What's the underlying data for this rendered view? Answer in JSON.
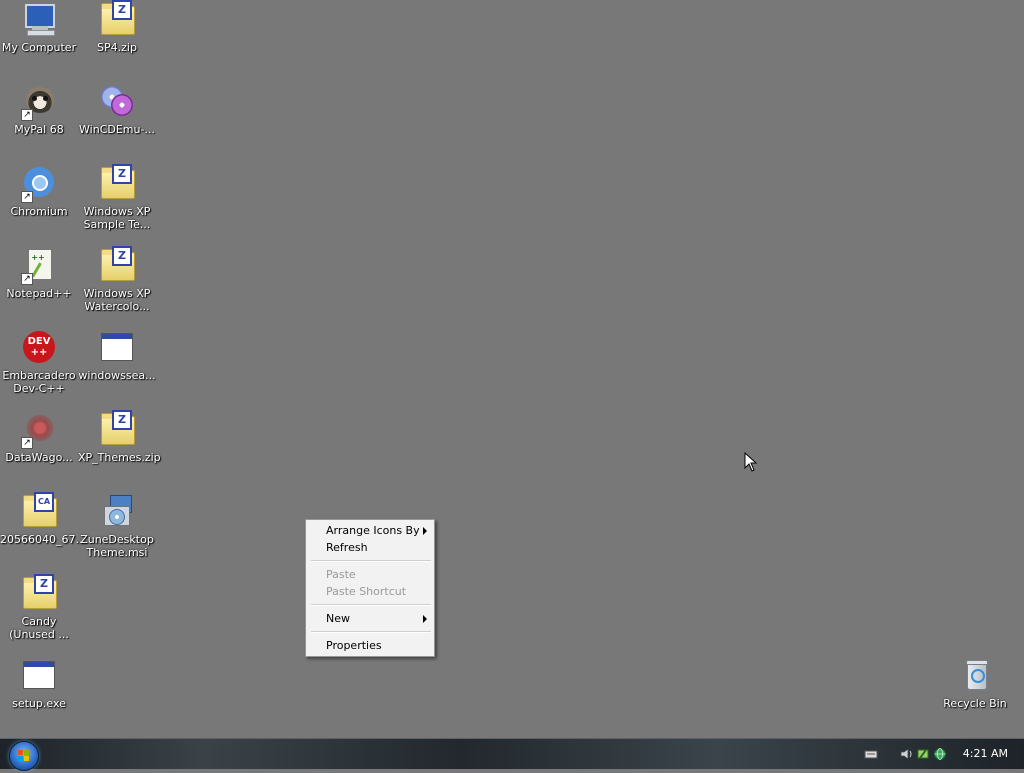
{
  "desktop": {
    "icons": [
      {
        "label": "My Computer",
        "icon": "my-computer-icon",
        "shortcut": false
      },
      {
        "label": "SP4.zip",
        "icon": "zip-folder-icon",
        "shortcut": false
      },
      {
        "label": "MyPal 68",
        "icon": "mypal-raccoon-icon",
        "shortcut": true
      },
      {
        "label": "WinCDEmu-...",
        "icon": "wincdemu-discs-icon",
        "shortcut": false
      },
      {
        "label": "Chromium",
        "icon": "chromium-icon",
        "shortcut": true
      },
      {
        "label": "Windows XP Sample Te...",
        "icon": "zip-folder-icon",
        "shortcut": false
      },
      {
        "label": "Notepad++",
        "icon": "notepad-plus-plus-icon",
        "shortcut": true
      },
      {
        "label": "Windows XP Watercolo...",
        "icon": "zip-folder-icon",
        "shortcut": false
      },
      {
        "label": "Embarcadero Dev-C++",
        "icon": "dev-cpp-icon",
        "shortcut": false
      },
      {
        "label": "windowssea...",
        "icon": "exe-window-icon",
        "shortcut": false
      },
      {
        "label": "DataWago...",
        "icon": "datawagon-icon",
        "shortcut": true
      },
      {
        "label": "XP_Themes.zip",
        "icon": "zip-folder-icon",
        "shortcut": false
      },
      {
        "label": "20566040_67...",
        "icon": "cab-folder-icon",
        "shortcut": false
      },
      {
        "label": "ZuneDesktopTheme.msi",
        "icon": "msi-installer-icon",
        "shortcut": false
      },
      {
        "label": "Candy (Unused ...",
        "icon": "zip-folder-icon",
        "shortcut": false
      },
      {
        "label": "setup.exe",
        "icon": "exe-window-icon",
        "shortcut": false
      },
      {
        "label": "Recycle Bin",
        "icon": "recycle-bin-icon",
        "shortcut": false
      }
    ],
    "badge_letters": {
      "zip": "Z",
      "cab": "CA",
      "dev": "DEV"
    }
  },
  "context_menu": {
    "items": [
      {
        "label": "Arrange Icons By",
        "enabled": true,
        "submenu": true
      },
      {
        "label": "Refresh",
        "enabled": true,
        "submenu": false
      },
      {
        "label": "Paste",
        "enabled": false,
        "submenu": false
      },
      {
        "label": "Paste Shortcut",
        "enabled": false,
        "submenu": false
      },
      {
        "label": "New",
        "enabled": true,
        "submenu": true
      },
      {
        "label": "Properties",
        "enabled": true,
        "submenu": false
      }
    ]
  },
  "taskbar": {
    "start_icon": "windows-orb-icon",
    "tray_icons": [
      "keyboard-icon",
      "speaker-icon",
      "safely-remove-icon",
      "network-icon"
    ],
    "clock": "4:21 AM"
  },
  "colors": {
    "desktop_bg": "#787878",
    "zip_badge": "#2f43a8"
  }
}
